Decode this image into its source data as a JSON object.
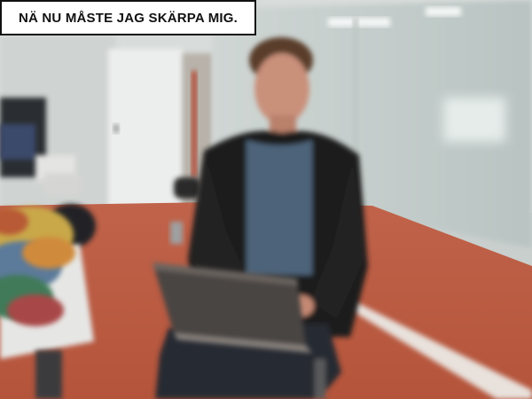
{
  "caption": {
    "text": "NÄ NU MÅSTE JAG SKÄRPA MIG."
  },
  "photo": {
    "subject": "person-with-laptop",
    "colors": {
      "floor": "#b85a40",
      "wall": "#d8dcda",
      "glass": "#c5d0ce",
      "sweater": "#4e6479",
      "jacket": "#1d1b1a",
      "laptop": "#4a4542",
      "pants": "#272a33"
    }
  }
}
